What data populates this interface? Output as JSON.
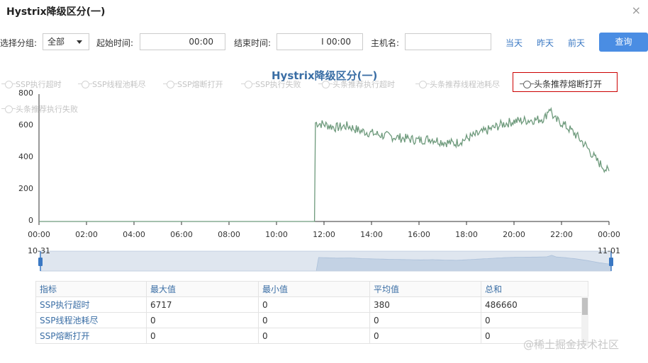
{
  "dialog": {
    "title": "Hystrix降级区分(一)",
    "close": "×"
  },
  "filters": {
    "group_label": "选择分组:",
    "group_value": "全部",
    "start_label": "起始时间:",
    "start_value": "00:00",
    "end_label": "结束时间:",
    "end_value": "I 00:00",
    "host_label": "主机名:",
    "host_value": "",
    "today": "当天",
    "yesterday": "昨天",
    "prev_day": "前天",
    "query": "查询"
  },
  "legend": [
    "SSP执行超时",
    "SSP线程池耗尽",
    "SSP熔断打开",
    "SSP执行失败",
    "头条推荐执行超时",
    "头条推荐线程池耗尽",
    "头条推荐熔断打开",
    "头条推荐执行失败"
  ],
  "chart_data": {
    "type": "line",
    "title": "Hystrix降级区分(一)",
    "xlabel": "",
    "ylabel": "",
    "x_ticks": [
      "00:00",
      "02:00",
      "04:00",
      "06:00",
      "08:00",
      "10:00",
      "12:00",
      "14:00",
      "16:00",
      "18:00",
      "20:00",
      "22:00",
      "00:00"
    ],
    "y_ticks": [
      "800",
      "600",
      "400",
      "200",
      "0"
    ],
    "ylim": [
      0,
      800
    ],
    "xlim_hours": [
      0,
      24
    ],
    "grid": false,
    "legend_position": "top",
    "series": [
      {
        "name": "头条推荐熔断打开",
        "color": "#6e9a7c",
        "x_hours": [
          0,
          11.6,
          11.62,
          12,
          12.5,
          13,
          13.5,
          14,
          14.5,
          15,
          15.5,
          16,
          16.5,
          17,
          17.5,
          18,
          18.5,
          19,
          19.5,
          20,
          20.5,
          21,
          21.3,
          21.5,
          21.7,
          22,
          22.5,
          23,
          23.5,
          24
        ],
        "values": [
          0,
          0,
          620,
          610,
          590,
          600,
          570,
          555,
          540,
          530,
          520,
          510,
          520,
          500,
          490,
          520,
          550,
          580,
          610,
          630,
          635,
          640,
          650,
          720,
          640,
          620,
          560,
          480,
          380,
          310
        ]
      }
    ]
  },
  "dataZoom": {
    "start": "10-31",
    "end": "11-01"
  },
  "table": {
    "headers": [
      "指标",
      "最大值",
      "最小值",
      "平均值",
      "总和"
    ],
    "rows": [
      [
        "SSP执行超时",
        "6717",
        "0",
        "380",
        "486660"
      ],
      [
        "SSP线程池耗尽",
        "0",
        "0",
        "0",
        "0"
      ],
      [
        "SSP熔断打开",
        "0",
        "0",
        "0",
        "0"
      ]
    ]
  },
  "watermark": "@稀土掘金技术社区"
}
